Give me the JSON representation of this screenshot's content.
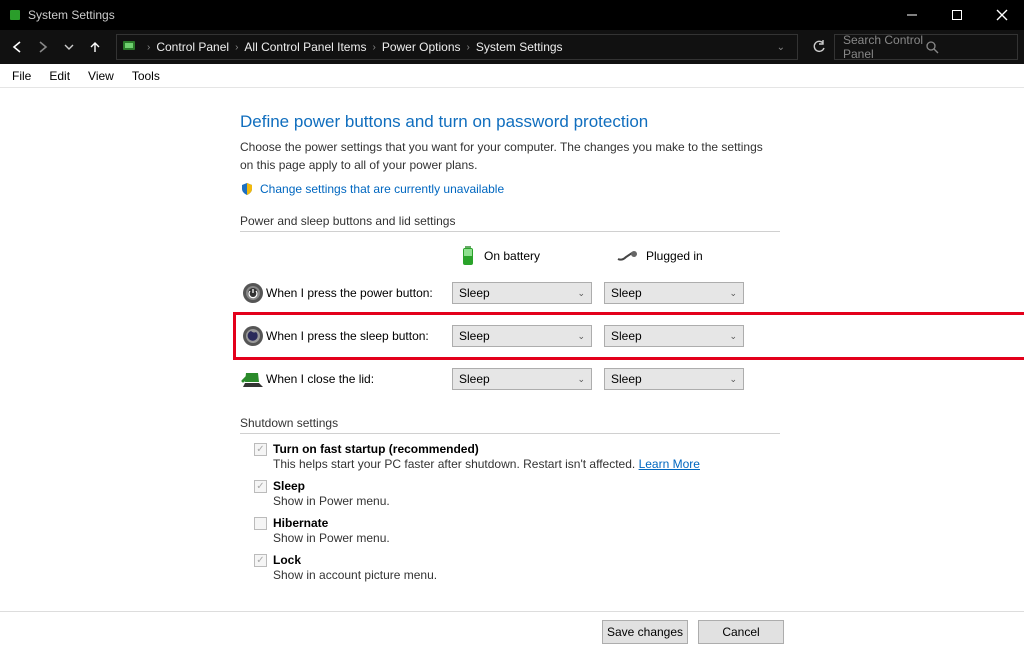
{
  "window": {
    "title": "System Settings"
  },
  "breadcrumb": [
    "Control Panel",
    "All Control Panel Items",
    "Power Options",
    "System Settings"
  ],
  "search": {
    "placeholder": "Search Control Panel"
  },
  "menu": [
    "File",
    "Edit",
    "View",
    "Tools"
  ],
  "page": {
    "heading": "Define power buttons and turn on password protection",
    "subtext": "Choose the power settings that you want for your computer. The changes you make to the settings on this page apply to all of your power plans.",
    "change_link": "Change settings that are currently unavailable"
  },
  "power_section": {
    "title": "Power and sleep buttons and lid settings",
    "col_battery": "On battery",
    "col_plugged": "Plugged in",
    "rows": [
      {
        "label": "When I press the power button:",
        "battery": "Sleep",
        "plugged": "Sleep"
      },
      {
        "label": "When I press the sleep button:",
        "battery": "Sleep",
        "plugged": "Sleep"
      },
      {
        "label": "When I close the lid:",
        "battery": "Sleep",
        "plugged": "Sleep"
      }
    ]
  },
  "shutdown_section": {
    "title": "Shutdown settings",
    "items": [
      {
        "label": "Turn on fast startup (recommended)",
        "bold": true,
        "checked": true,
        "desc": "This helps start your PC faster after shutdown. Restart isn't affected. ",
        "learn_more": "Learn More"
      },
      {
        "label": "Sleep",
        "bold": true,
        "checked": true,
        "desc": "Show in Power menu."
      },
      {
        "label": "Hibernate",
        "bold": true,
        "checked": false,
        "desc": "Show in Power menu."
      },
      {
        "label": "Lock",
        "bold": true,
        "checked": true,
        "desc": "Show in account picture menu."
      }
    ]
  },
  "buttons": {
    "save": "Save changes",
    "cancel": "Cancel"
  }
}
